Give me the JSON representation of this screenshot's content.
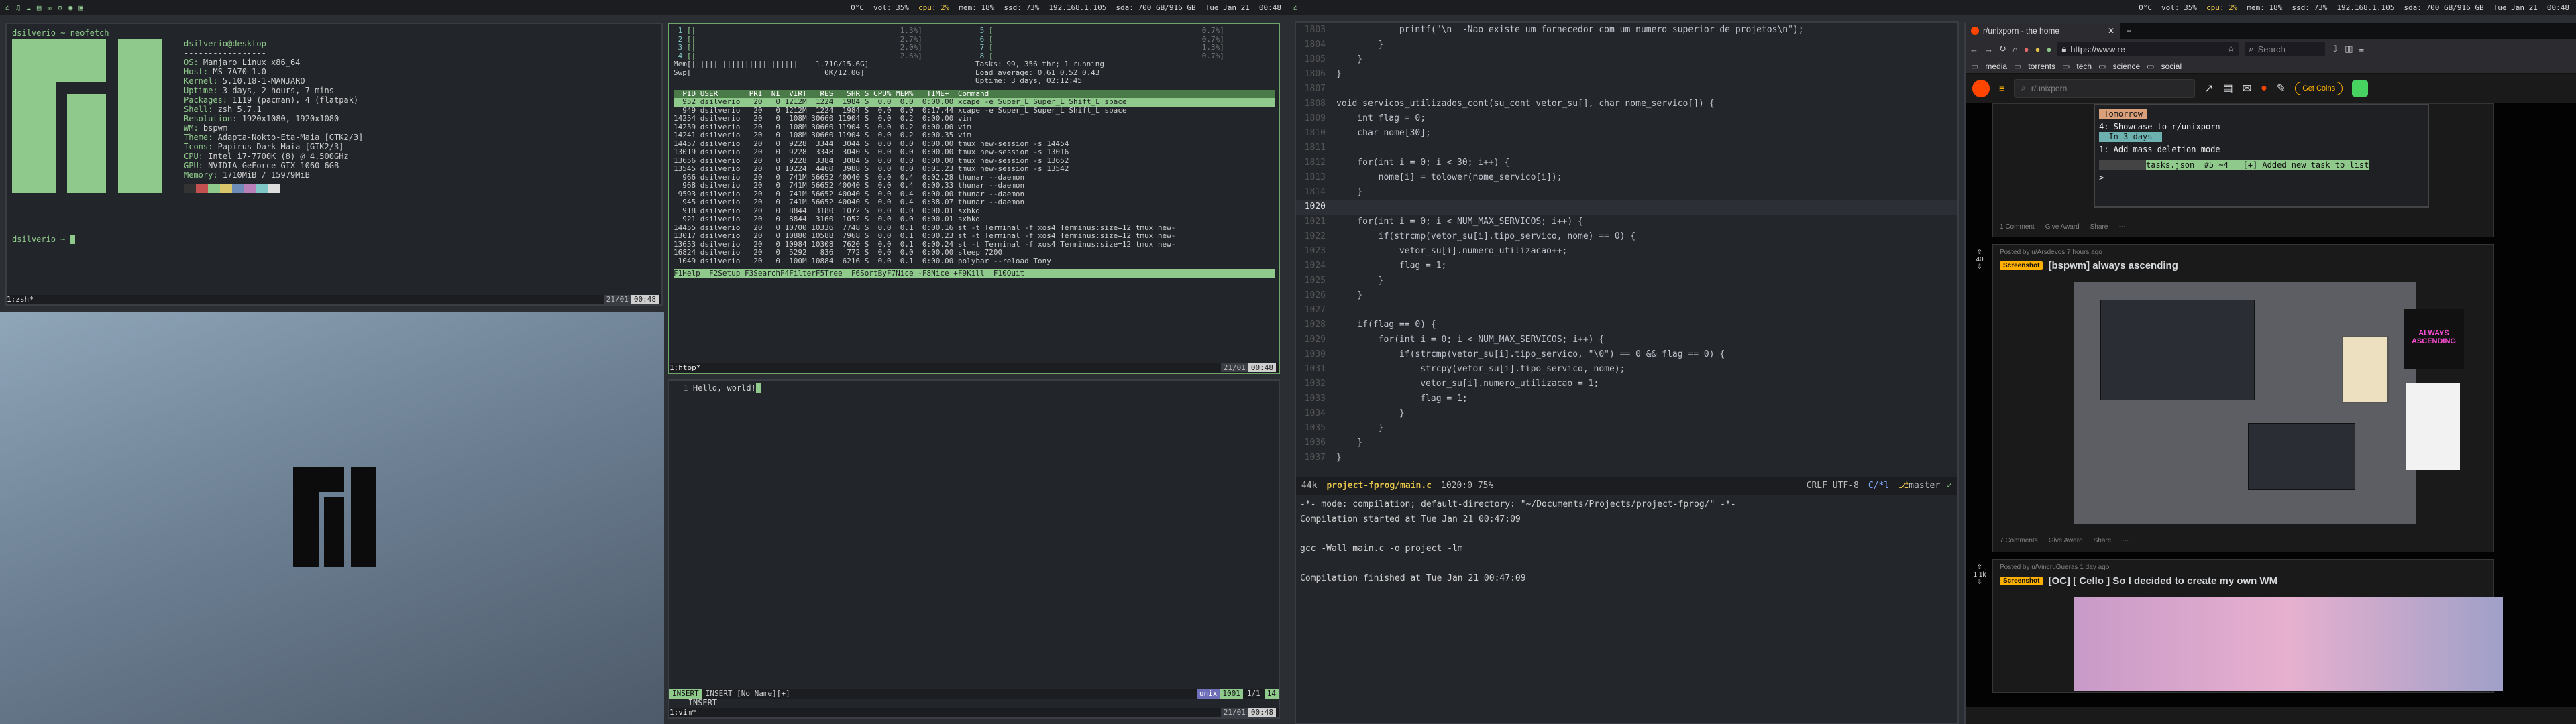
{
  "bar": {
    "ws_icons": [
      "⌂",
      "♫",
      "☁",
      "▤",
      "✉",
      "⚙",
      "◉",
      "▣"
    ],
    "stats": [
      {
        "text": "0°C",
        "cls": ""
      },
      {
        "text": "vol: 35%",
        "cls": ""
      },
      {
        "text": "cpu: 2%",
        "cls": "warn"
      },
      {
        "text": "mem: 18%",
        "cls": ""
      },
      {
        "text": "ssd: 73%",
        "cls": ""
      },
      {
        "text": "192.168.1.105",
        "cls": ""
      },
      {
        "text": "sda: 700 GB/916 GB",
        "cls": ""
      },
      {
        "text": "Tue Jan 21",
        "cls": ""
      },
      {
        "text": "00:48",
        "cls": ""
      }
    ]
  },
  "neofetch": {
    "prompt": "dsilverio ~ neofetch",
    "header": "dsilverio@desktop",
    "sep": "-----------------",
    "lines": [
      [
        "OS:",
        "Manjaro Linux x86_64"
      ],
      [
        "Host:",
        "MS-7A70 1.0"
      ],
      [
        "Kernel:",
        "5.10.18-1-MANJARO"
      ],
      [
        "Uptime:",
        "3 days, 2 hours, 7 mins"
      ],
      [
        "Packages:",
        "1119 (pacman), 4 (flatpak)"
      ],
      [
        "Shell:",
        "zsh 5.7.1"
      ],
      [
        "Resolution:",
        "1920x1080, 1920x1080"
      ],
      [
        "WM:",
        "bspwm"
      ],
      [
        "Theme:",
        "Adapta-Nokto-Eta-Maia [GTK2/3]"
      ],
      [
        "Icons:",
        "Papirus-Dark-Maia [GTK2/3]"
      ],
      [
        "CPU:",
        "Intel i7-7700K (8) @ 4.500GHz"
      ],
      [
        "GPU:",
        "NVIDIA GeForce GTX 1060 6GB"
      ],
      [
        "Memory:",
        "1710MiB / 15979MiB"
      ]
    ],
    "prompt2": "dsilverio ~",
    "status": "1:zsh*",
    "time": "00:48"
  },
  "htop": {
    "cpus": [
      {
        "id": "1",
        "bar": "[|",
        "pct": "1.3%"
      },
      {
        "id": "2",
        "bar": "[|",
        "pct": "2.7%"
      },
      {
        "id": "3",
        "bar": "[|",
        "pct": "2.0%"
      },
      {
        "id": "4",
        "bar": "[|",
        "pct": "2.6%"
      },
      {
        "id": "5",
        "bar": "[",
        "pct": "0.7%"
      },
      {
        "id": "6",
        "bar": "[",
        "pct": "0.7%"
      },
      {
        "id": "7",
        "bar": "[",
        "pct": "1.3%"
      },
      {
        "id": "8",
        "bar": "[",
        "pct": "0.7%"
      }
    ],
    "mem": "Mem[||||||||||||||||||||||||    1.71G/15.6G]",
    "swp": "Swp[                              0K/12.0G]",
    "tasks": "Tasks: 99, 356 thr; 1 running",
    "load": "Load average: 0.61 0.52 0.43",
    "uptime": "Uptime: 3 days, 02:12:45",
    "header": "  PID USER       PRI  NI  VIRT   RES   SHR S CPU% MEM%   TIME+  Command",
    "rows": [
      "  952 dsilverio   20   0 1212M  1224  1984 S  0.0  0.0  0:00.00 xcape -e Super_L Super_L Shift_L space",
      "  949 dsilverio   20   0 1212M  1224  1984 S  0.0  0.0  0:17.44 xcape -e Super_L Super_L Shift_L space",
      "14254 dsilverio   20   0  108M 30660 11904 S  0.0  0.2  0:00.00 vim",
      "14259 dsilverio   20   0  108M 30660 11904 S  0.0  0.2  0:00.00 vim",
      "14241 dsilverio   20   0  108M 30660 11904 S  0.0  0.2  0:00.35 vim",
      "14457 dsilverio   20   0  9228  3344  3044 S  0.0  0.0  0:00.00 tmux new-session -s 14454",
      "13019 dsilverio   20   0  9228  3348  3040 S  0.0  0.0  0:00.00 tmux new-session -s 13016",
      "13656 dsilverio   20   0  9228  3384  3084 S  0.0  0.0  0:00.00 tmux new-session -s 13652",
      "13545 dsilverio   20   0 10224  4460  3988 S  0.0  0.0  0:01.23 tmux new-session -s 13542",
      "  966 dsilverio   20   0  741M 56652 40040 S  0.0  0.4  0:02.28 thunar --daemon",
      "  968 dsilverio   20   0  741M 56652 40040 S  0.0  0.4  0:00.33 thunar --daemon",
      " 9593 dsilverio   20   0  741M 56652 40040 S  0.0  0.4  0:00.00 thunar --daemon",
      "  945 dsilverio   20   0  741M 56652 40040 S  0.0  0.4  0:38.07 thunar --daemon",
      "  918 dsilverio   20   0  8844  3180  1072 S  0.0  0.0  0:00.01 sxhkd",
      "  921 dsilverio   20   0  8844  3160  1052 S  0.0  0.0  0:00.01 sxhkd",
      "14455 dsilverio   20   0 10700 10336  7748 S  0.0  0.1  0:00.16 st -t Terminal -f xos4 Terminus:size=12 tmux new-",
      "13017 dsilverio   20   0 10880 10588  7968 S  0.0  0.1  0:00.23 st -t Terminal -f xos4 Terminus:size=12 tmux new-",
      "13653 dsilverio   20   0 10984 10308  7620 S  0.0  0.1  0:00.24 st -t Terminal -f xos4 Terminus:size=12 tmux new-",
      "16824 dsilverio   20   0  5292   836   772 S  0.0  0.0  0:00.00 sleep 7200",
      " 1049 dsilverio   20   0  100M 10884  6216 S  0.0  0.1  0:00.00 polybar --reload Tony"
    ],
    "fkeys": "F1Help  F2Setup F3SearchF4FilterF5Tree  F6SortByF7Nice -F8Nice +F9Kill  F10Quit",
    "status": "1:htop*",
    "time": "00:48"
  },
  "vim": {
    "text": "Hello, world!",
    "mode_line": "INSERT  [No Name][+]",
    "mode": "unix",
    "enc": "1001",
    "pos": "1/1",
    "col": "14",
    "insert": "-- INSERT --",
    "status": "1:vim*",
    "time": "00:48"
  },
  "emacs": {
    "lines": [
      {
        "n": "1803",
        "code": "            printf(\"\\n  -Nao existe um fornecedor com um numero superior de projetos\\n\");"
      },
      {
        "n": "1804",
        "code": "        }"
      },
      {
        "n": "1805",
        "code": "    }"
      },
      {
        "n": "1806",
        "code": "}"
      },
      {
        "n": "1807",
        "code": ""
      },
      {
        "n": "1808",
        "code": "void servicos_utilizados_cont(su_cont vetor_su[], char nome_servico[]) {"
      },
      {
        "n": "1809",
        "code": "    int flag = 0;"
      },
      {
        "n": "1810",
        "code": "    char nome[30];"
      },
      {
        "n": "1811",
        "code": ""
      },
      {
        "n": "1812",
        "code": "    for(int i = 0; i < 30; i++) {"
      },
      {
        "n": "1813",
        "code": "        nome[i] = tolower(nome_servico[i]);"
      },
      {
        "n": "1814",
        "code": "    }"
      },
      {
        "n": "1020",
        "code": ""
      },
      {
        "n": "1021",
        "code": "    for(int i = 0; i < NUM_MAX_SERVICOS; i++) {"
      },
      {
        "n": "1022",
        "code": "        if(strcmp(vetor_su[i].tipo_servico, nome) == 0) {"
      },
      {
        "n": "1023",
        "code": "            vetor_su[i].numero_utilizacao++;"
      },
      {
        "n": "1024",
        "code": "            flag = 1;"
      },
      {
        "n": "1025",
        "code": "        }"
      },
      {
        "n": "1026",
        "code": "    }"
      },
      {
        "n": "1027",
        "code": ""
      },
      {
        "n": "1028",
        "code": "    if(flag == 0) {"
      },
      {
        "n": "1029",
        "code": "        for(int i = 0; i < NUM_MAX_SERVICOS; i++) {"
      },
      {
        "n": "1030",
        "code": "            if(strcmp(vetor_su[i].tipo_servico, \"\\0\") == 0 && flag == 0) {"
      },
      {
        "n": "1031",
        "code": "                strcpy(vetor_su[i].tipo_servico, nome);"
      },
      {
        "n": "1032",
        "code": "                vetor_su[i].numero_utilizacao = 1;"
      },
      {
        "n": "1033",
        "code": "                flag = 1;"
      },
      {
        "n": "1034",
        "code": "            }"
      },
      {
        "n": "1035",
        "code": "        }"
      },
      {
        "n": "1036",
        "code": "    }"
      },
      {
        "n": "1037",
        "code": "}"
      }
    ],
    "modeline": {
      "size": "44k",
      "file": "project-fprog/main.c",
      "pos": "1020:0 75%",
      "enc": "CRLF UTF-8",
      "mode": "C/*l",
      "branch": "master"
    },
    "comp": [
      "-*- mode: compilation; default-directory: \"~/Documents/Projects/project-fprog/\" -*-",
      "Compilation started at Tue Jan 21 00:47:09",
      "",
      "gcc -Wall main.c -o project -lm",
      "",
      "Compilation finished at Tue Jan 21 00:47:09"
    ]
  },
  "browser": {
    "tab_title": "r/unixporn - the home",
    "url": "https://www.re",
    "search_placeholder": "Search",
    "bookmarks": [
      "media",
      "torrents",
      "tech",
      "science",
      "social"
    ],
    "reddit_search": "r/unixporn",
    "get_coins": "Get Coins",
    "card0": {
      "term_lines": [
        " Tomorrow ",
        "4: Showcase to r/unixporn",
        "",
        "  In 3 days  ",
        "1: Add mass deletion mode"
      ],
      "task_bar": "tasks.json  #5 ~4   [+] Added new task to list",
      "comments": "1 Comment",
      "award": "Give Award",
      "share": "Share"
    },
    "card1": {
      "votes": "40",
      "posted": "Posted by u/Arsdevos   7 hours ago",
      "flair": "Screenshot",
      "title": "[bspwm] always ascending",
      "comments": "7 Comments",
      "award": "Give Award",
      "share": "Share",
      "sticker": "ALWAYS ASCENDING"
    },
    "card2": {
      "votes": "1.1k",
      "posted": "Posted by u/VincruGueras   1 day ago",
      "flair": "Screenshot",
      "title": "[OC] [ Cello ] So I decided to create my own WM"
    }
  },
  "colors": {
    "accent": "#8fc98b",
    "flair": "#ffb000",
    "reddit": "#ff4500"
  }
}
